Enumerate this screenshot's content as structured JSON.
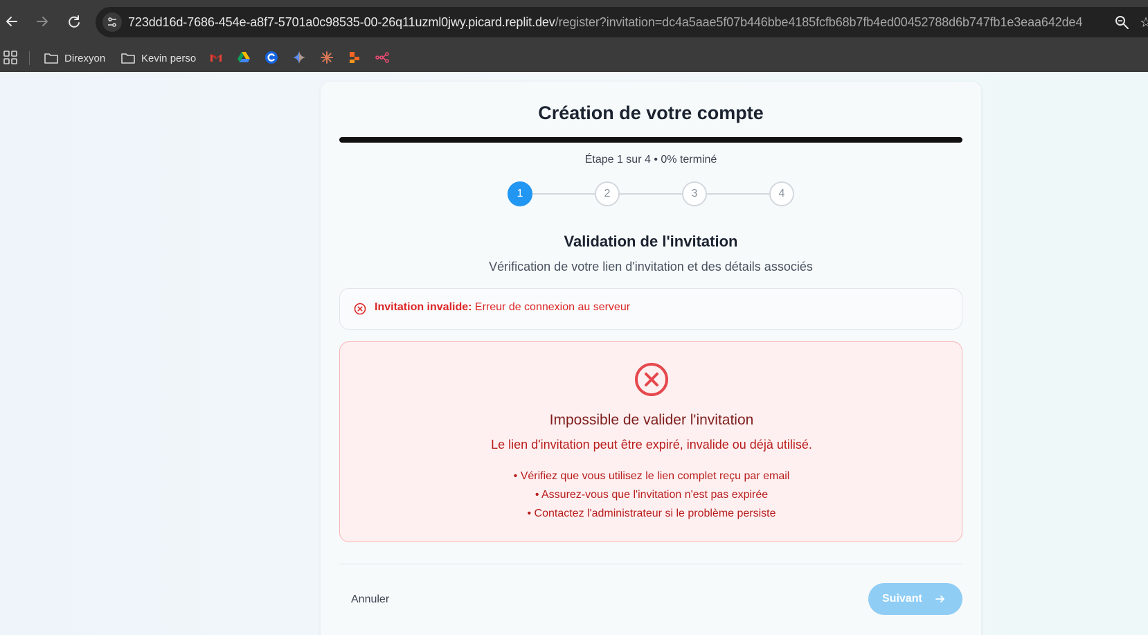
{
  "browser": {
    "url_host": "723dd16d-7686-454e-a8f7-5701a0c98535-00-26q11uzml0jwy.picard.replit.dev",
    "url_path": "/register?invitation=dc4a5aae5f07b446bbe4185fcfb68b7fb4ed00452788d6b747fb1e3eaa642de4",
    "bookmarks": [
      {
        "label": "Direxyon",
        "icon": "folder-icon"
      },
      {
        "label": "Kevin perso",
        "icon": "folder-icon"
      }
    ],
    "bookmark_icons": [
      "gmail-icon",
      "google-drive-icon",
      "c-app-icon",
      "gemini-icon",
      "claude-icon",
      "orange-app-icon",
      "workflow-icon"
    ]
  },
  "card": {
    "title": "Création de votre compte",
    "progress_percent": 0,
    "step_text": "Étape 1 sur 4 • 0% terminé",
    "steps": [
      "1",
      "2",
      "3",
      "4"
    ],
    "active_step": 1,
    "section_title": "Validation de l'invitation",
    "section_subtitle": "Vérification de votre lien d'invitation et des détails associés"
  },
  "alert": {
    "label": "Invitation invalide:",
    "message": " Erreur de connexion au serveur"
  },
  "error": {
    "title": "Impossible de valider l'invitation",
    "description": "Le lien d'invitation peut être expiré, invalide ou déjà utilisé.",
    "tips": [
      "• Vérifiez que vous utilisez le lien complet reçu par email",
      "• Assurez-vous que l'invitation n'est pas expirée",
      "• Contactez l'administrateur si le problème persiste"
    ]
  },
  "footer": {
    "cancel_label": "Annuler",
    "next_label": "Suivant"
  },
  "colors": {
    "accent": "#2196f3",
    "error": "#dc2626",
    "next_disabled": "#8fcdf5"
  }
}
